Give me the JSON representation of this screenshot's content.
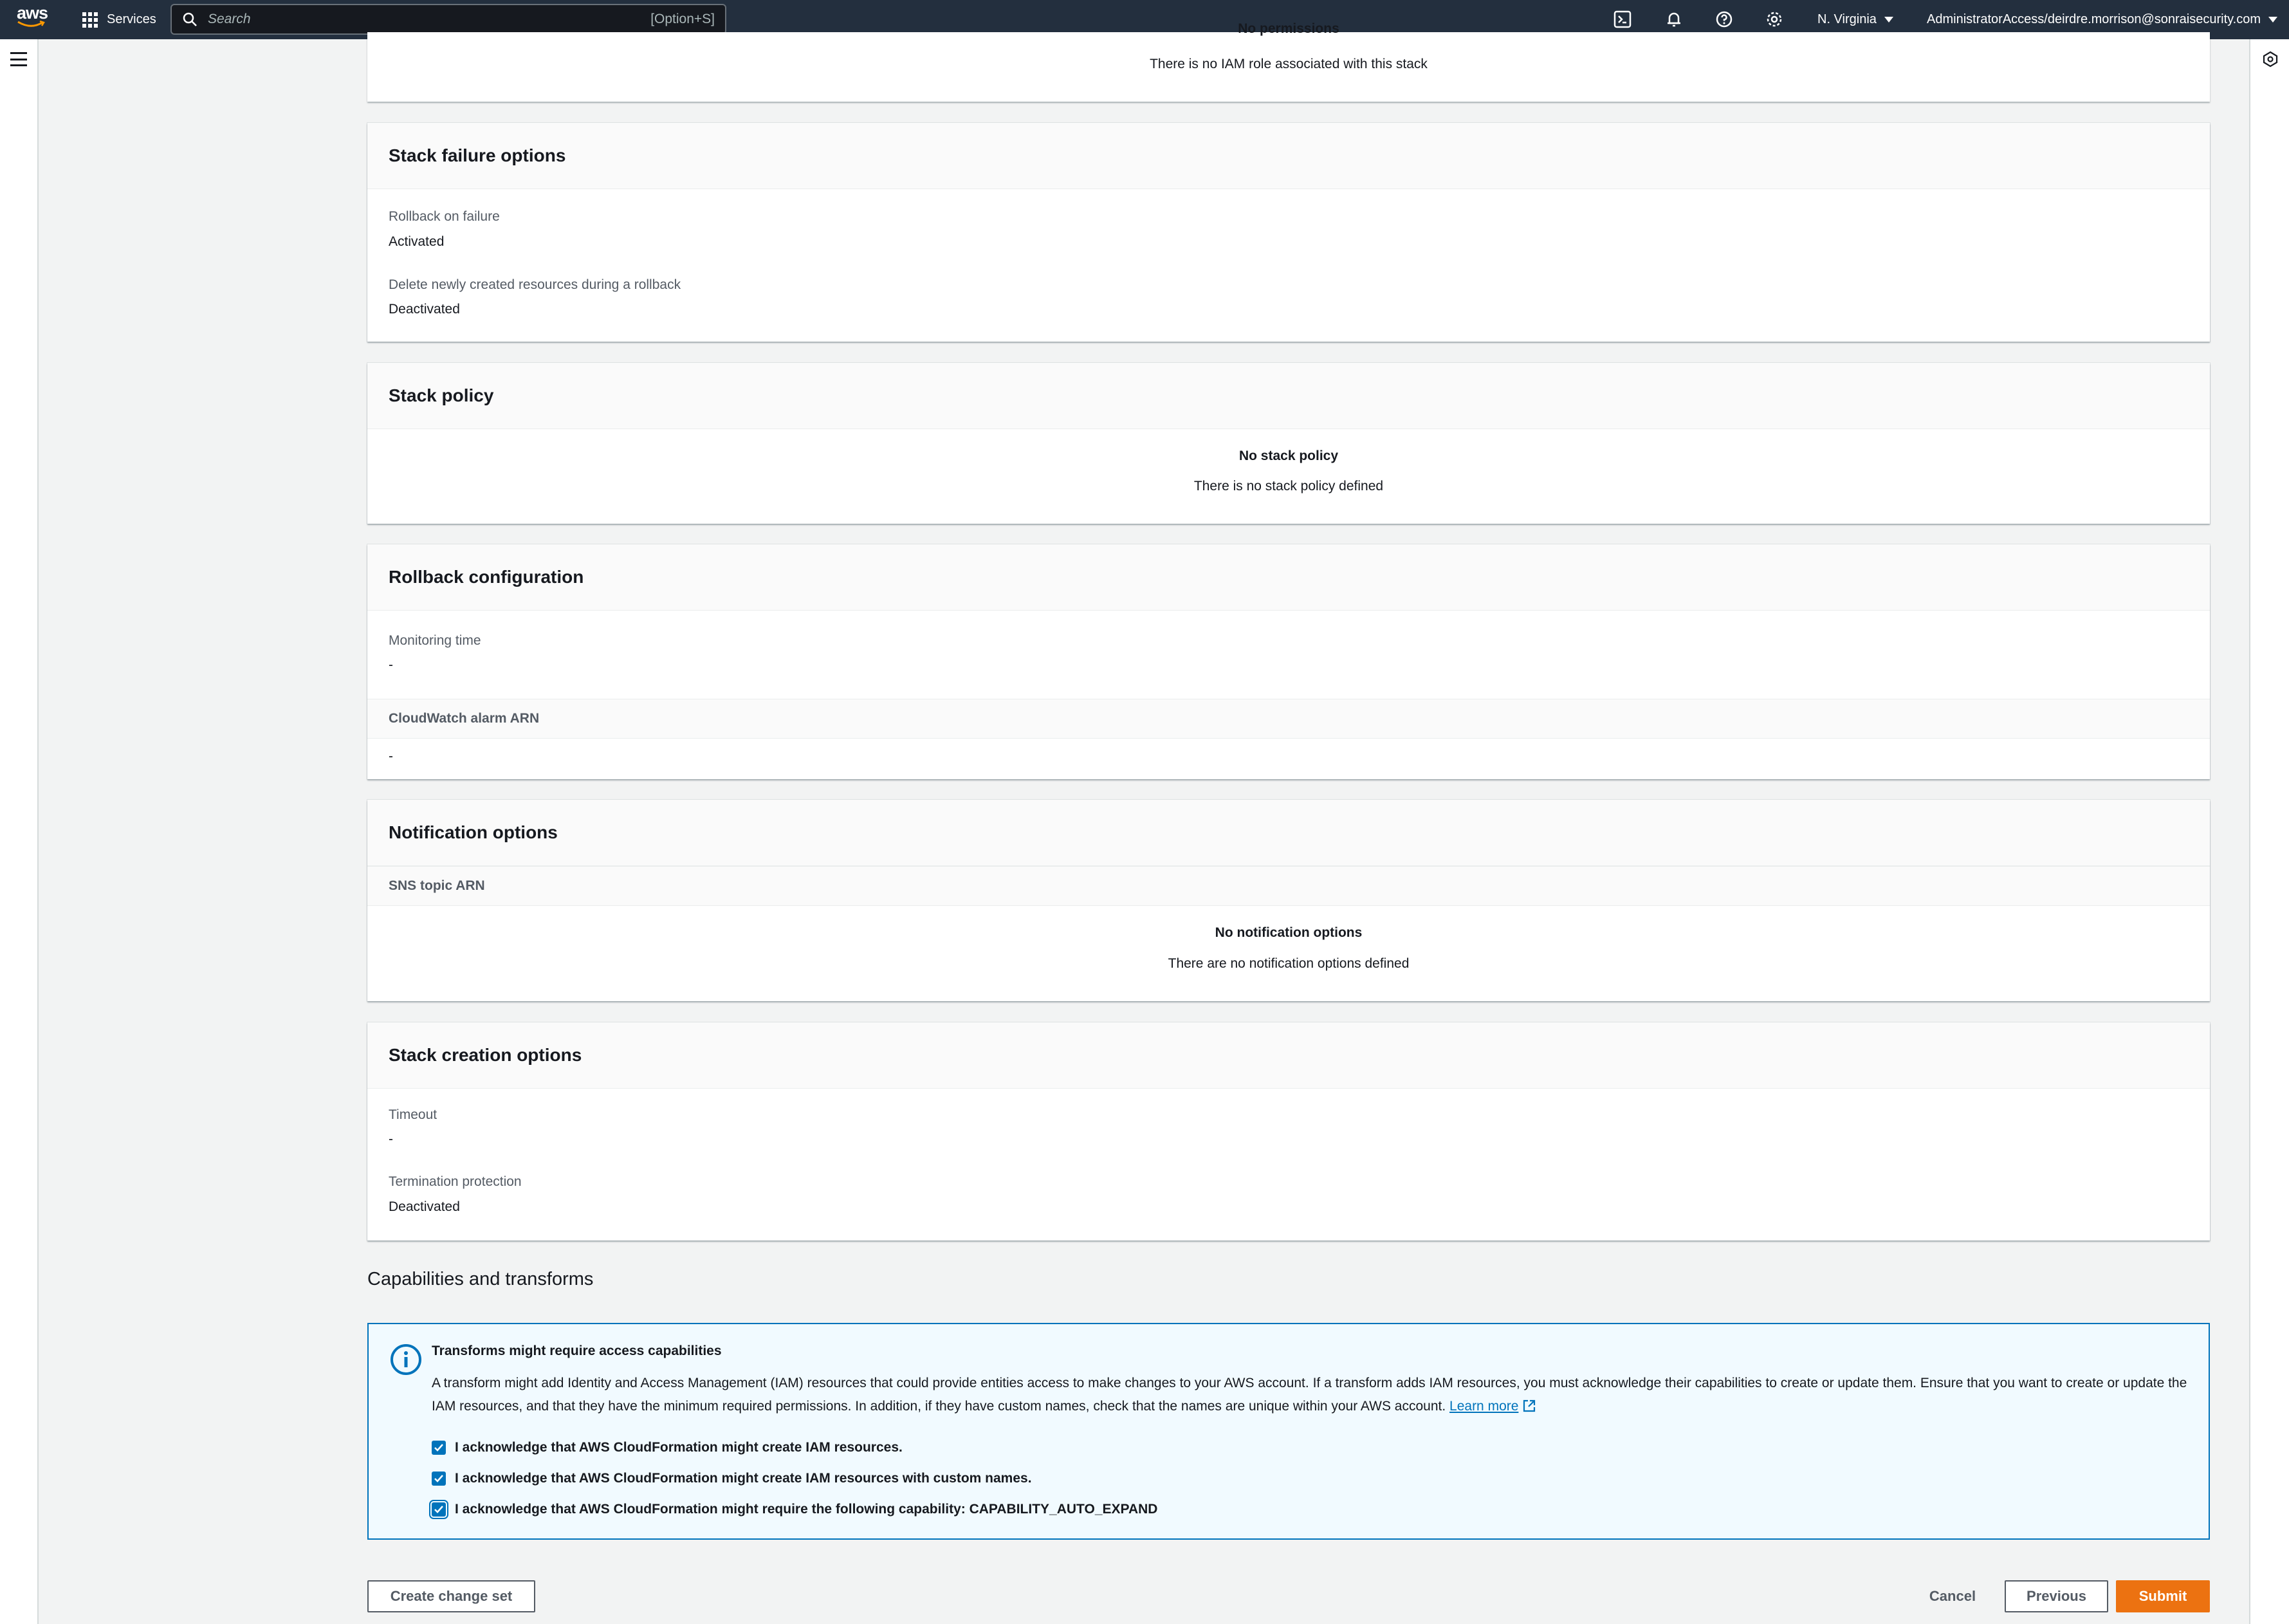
{
  "topnav": {
    "services_label": "Services",
    "search_placeholder": "Search",
    "search_shortcut": "[Option+S]",
    "region_label": "N. Virginia",
    "account_label": "AdministratorAccess/deirdre.morrison@sonraisecurity.com"
  },
  "permissions_panel": {
    "empty_title": "No permissions",
    "empty_text": "There is no IAM role associated with this stack"
  },
  "stack_failure_options": {
    "title": "Stack failure options",
    "rollback_label": "Rollback on failure",
    "rollback_value": "Activated",
    "delete_label": "Delete newly created resources during a rollback",
    "delete_value": "Deactivated"
  },
  "stack_policy": {
    "title": "Stack policy",
    "empty_title": "No stack policy",
    "empty_text": "There is no stack policy defined"
  },
  "rollback_configuration": {
    "title": "Rollback configuration",
    "monitoring_label": "Monitoring time",
    "monitoring_value": "-",
    "alarm_header": "CloudWatch alarm ARN",
    "alarm_value": "-"
  },
  "notification_options": {
    "title": "Notification options",
    "sns_header": "SNS topic ARN",
    "empty_title": "No notification options",
    "empty_text": "There are no notification options defined"
  },
  "stack_creation_options": {
    "title": "Stack creation options",
    "timeout_label": "Timeout",
    "timeout_value": "-",
    "termination_label": "Termination protection",
    "termination_value": "Deactivated"
  },
  "capabilities": {
    "heading": "Capabilities and transforms",
    "alert_title": "Transforms might require access capabilities",
    "alert_body": "A transform might add Identity and Access Management (IAM) resources that could provide entities access to make changes to your AWS account. If a transform adds IAM resources, you must acknowledge their capabilities to create or update them. Ensure that you want to create or update the IAM resources, and that they have the minimum required permissions. In addition, if they have custom names, check that the names are unique within your AWS account.",
    "learn_more": "Learn more",
    "acknowledgements": [
      "I acknowledge that AWS CloudFormation might create IAM resources.",
      "I acknowledge that AWS CloudFormation might create IAM resources with custom names.",
      "I acknowledge that AWS CloudFormation might require the following capability: CAPABILITY_AUTO_EXPAND"
    ]
  },
  "footer": {
    "create_change_set": "Create change set",
    "cancel": "Cancel",
    "previous": "Previous",
    "submit": "Submit"
  },
  "colors": {
    "nav_bg": "#232f3e",
    "primary": "#ec7211",
    "info_border": "#0073bb",
    "info_bg": "#f1faff"
  }
}
